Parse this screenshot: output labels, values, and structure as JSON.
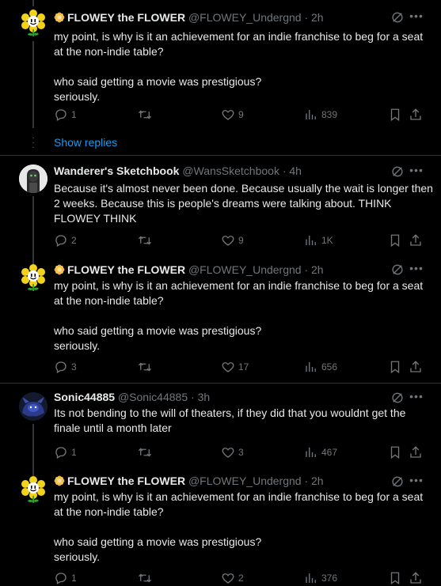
{
  "tweets": [
    {
      "name": "FLOWEY the FLOWER",
      "handle": "@FLOWEY_Undergnd",
      "time": "· 2h",
      "text": "my point, is why is it an achievement for an indie franchise to beg for a seat at the non-indie table?\n\nwho said getting a movie was prestigious?\nseriously.",
      "replies": "1",
      "retweets": "",
      "likes": "9",
      "views": "839"
    },
    {
      "name": "Wanderer's Sketchbook",
      "handle": "@WansSketchbook",
      "time": "· 4h",
      "text": "Because it's almost never been done. Because usually the wait is longer then 2 weeks. Because this is people's dreams were talking about. THINK FLOWEY THINK",
      "replies": "2",
      "retweets": "",
      "likes": "9",
      "views": "1K"
    },
    {
      "name": "FLOWEY the FLOWER",
      "handle": "@FLOWEY_Undergnd",
      "time": "· 2h",
      "text": "my point, is why is it an achievement for an indie franchise to beg for a seat at the non-indie table?\n\nwho said getting a movie was prestigious?\nseriously.",
      "replies": "3",
      "retweets": "",
      "likes": "17",
      "views": "656"
    },
    {
      "name": "Sonic44885",
      "handle": "@Sonic44885",
      "time": "· 3h",
      "text": "Its not bending to the will of theaters, if they did that you wouldnt get the finale until a month later",
      "replies": "1",
      "retweets": "",
      "likes": "3",
      "views": "467"
    },
    {
      "name": "FLOWEY the FLOWER",
      "handle": "@FLOWEY_Undergnd",
      "time": "· 2h",
      "text": "my point, is why is it an achievement for an indie franchise to beg for a seat at the non-indie table?\n\nwho said getting a movie was prestigious?\nseriously.",
      "replies": "1",
      "retweets": "",
      "likes": "2",
      "views": "376"
    }
  ],
  "show_replies_label": "Show replies",
  "colors": {
    "background": "#000000",
    "text": "#e7e9ea",
    "muted": "#71767b",
    "accent": "#1d9bf0",
    "divider": "#2f3336"
  }
}
